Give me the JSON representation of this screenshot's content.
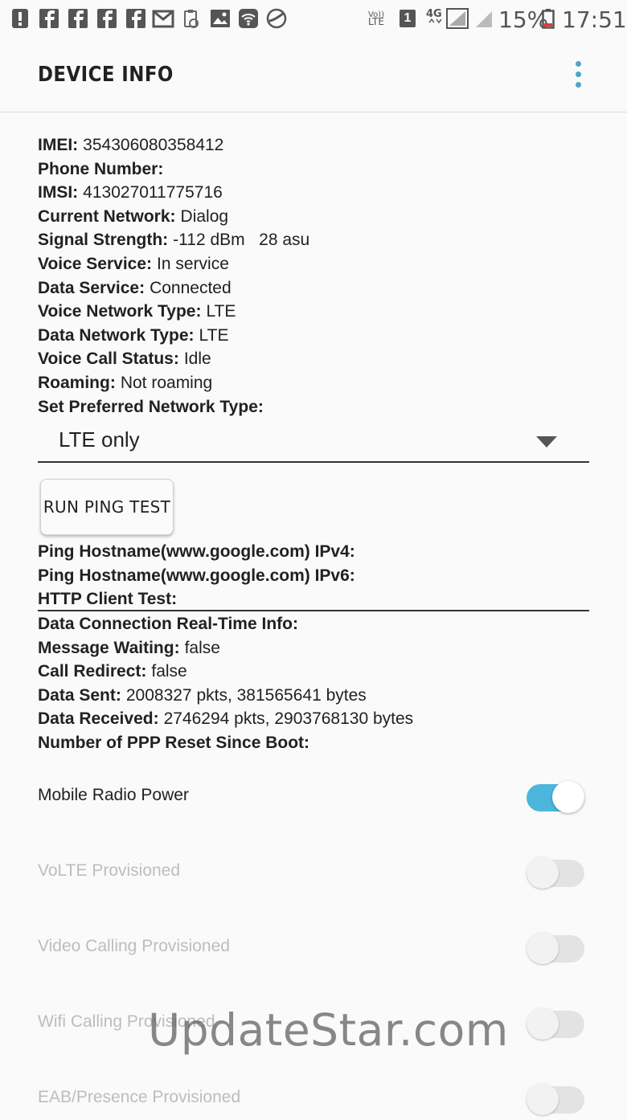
{
  "status_bar": {
    "battery_percent": "15%",
    "time": "17:51",
    "sim_slot": "1",
    "network_label": "4G",
    "volte_label": "LTE",
    "left_icons": [
      "alert-icon",
      "facebook-icon",
      "facebook-icon",
      "facebook-icon",
      "facebook-icon",
      "gmail-icon",
      "clipboard-icon",
      "image-icon",
      "wifi-icon",
      "browser-icon"
    ]
  },
  "appbar": {
    "title": "DEVICE INFO"
  },
  "info": [
    {
      "key": "IMEI:",
      "value": "354306080358412"
    },
    {
      "key": "Phone Number:",
      "value": ""
    },
    {
      "key": "IMSI:",
      "value": "413027011775716"
    },
    {
      "key": "Current Network:",
      "value": "Dialog"
    },
    {
      "key": "Signal Strength:",
      "value": "-112 dBm   28 asu"
    },
    {
      "key": "Voice Service:",
      "value": "In service"
    },
    {
      "key": "Data Service:",
      "value": "Connected"
    },
    {
      "key": "Voice Network Type:",
      "value": "LTE"
    },
    {
      "key": "Data Network Type:",
      "value": "LTE"
    },
    {
      "key": "Voice Call Status:",
      "value": "Idle"
    },
    {
      "key": "Roaming:",
      "value": "Not roaming"
    },
    {
      "key": "Set Preferred Network Type:",
      "value": ""
    }
  ],
  "preferred_network": {
    "selected": "LTE only"
  },
  "ping_button": {
    "label": "RUN PING TEST"
  },
  "ping_info": [
    {
      "key": "Ping Hostname(www.google.com) IPv4:",
      "value": ""
    },
    {
      "key": "Ping Hostname(www.google.com) IPv6:",
      "value": ""
    },
    {
      "key": "HTTP Client Test:",
      "value": ""
    }
  ],
  "conn_info": [
    {
      "key": "Data Connection Real-Time Info:",
      "value": ""
    },
    {
      "key": "Message Waiting:",
      "value": "false"
    },
    {
      "key": "Call Redirect:",
      "value": "false"
    },
    {
      "key": "Data Sent:",
      "value": "2008327 pkts, 381565641 bytes"
    },
    {
      "key": "Data Received:",
      "value": "2746294 pkts, 2903768130 bytes"
    },
    {
      "key": "Number of PPP Reset Since Boot:",
      "value": ""
    }
  ],
  "toggles": [
    {
      "label": "Mobile Radio Power",
      "on": true,
      "enabled": true
    },
    {
      "label": "VoLTE Provisioned",
      "on": false,
      "enabled": false
    },
    {
      "label": "Video Calling Provisioned",
      "on": false,
      "enabled": false
    },
    {
      "label": "Wifi Calling Provisioned",
      "on": false,
      "enabled": false
    },
    {
      "label": "EAB/Presence Provisioned",
      "on": false,
      "enabled": false
    }
  ],
  "watermark": "UpdateStar.com",
  "colors": {
    "accent": "#4db6dd",
    "menu_dots": "#4fa6c4"
  }
}
